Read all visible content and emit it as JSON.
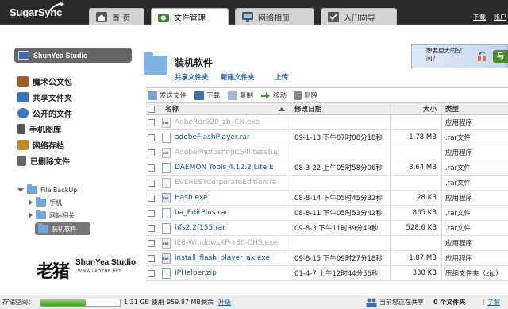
{
  "app": {
    "logo": "SugarSync"
  },
  "tabs": [
    {
      "label": "首 页"
    },
    {
      "label": "文件管理"
    },
    {
      "label": "网络相册"
    },
    {
      "label": "入门向导"
    }
  ],
  "top_links": [
    "下载",
    "账户"
  ],
  "sidebar": {
    "studio": "ShunYea Studio",
    "items": [
      {
        "label": "魔术公文包",
        "color": "#a0602a"
      },
      {
        "label": "共享文件夹",
        "color": "#3b74c0"
      },
      {
        "label": "公开的文件",
        "color": "#3b74c0"
      },
      {
        "label": "手机图库",
        "color": "#555555"
      },
      {
        "label": "网络存档",
        "color": "#c08a2a"
      },
      {
        "label": "已删除文件",
        "color": "#666666"
      }
    ],
    "tree": {
      "root": "File BackUp",
      "children": [
        "手机",
        "网站相关",
        "装机软件"
      ],
      "selected": "装机软件"
    },
    "brand": {
      "logo": "老猪",
      "name": "ShunYea Studio",
      "url": "WWW.LAOZHE.NET"
    }
  },
  "main": {
    "folder_title": "装机软件",
    "folder_actions": [
      "共享文件夹",
      "新建文件夹",
      "上传"
    ],
    "banner": {
      "text": "想要更大的空间？",
      "button": "马"
    },
    "toolbar": [
      "发送文件",
      "下载",
      "复制",
      "移动",
      "删除"
    ],
    "columns": {
      "name": "名称",
      "date": "修改日期",
      "size": "大小",
      "type": "类型"
    },
    "files": [
      {
        "name": "AdbeRdr920_zh_CN.exe",
        "date": "",
        "size": "",
        "type": "应用程序",
        "kind": "exe",
        "dim": true
      },
      {
        "name": "adobeFlashPlayer.rar",
        "date": "09-1-13 下午07时08分18秒",
        "size": "1.78 MB",
        "type": ".rar文件",
        "kind": "file",
        "dim": false
      },
      {
        "name": "AdobePhotoshopCS4litesetup",
        "date": "",
        "size": "",
        "type": "应用程序",
        "kind": "exe",
        "dim": true
      },
      {
        "name": "DAEMON Tools 4.12.2 Lite E",
        "date": "08-3-22 上午05时58分06秒",
        "size": "3.64 MB",
        "type": ".rar文件",
        "kind": "file",
        "dim": false
      },
      {
        "name": "EVERESTCorporateEdition.ra",
        "date": "",
        "size": "",
        "type": ".rar文件",
        "kind": "file",
        "dim": true
      },
      {
        "name": "Hash.exe",
        "date": "08-8-14 下午05时45分32秒",
        "size": "28 KB",
        "type": "应用程序",
        "kind": "exe",
        "dim": false
      },
      {
        "name": "ha_EditPlus.rar",
        "date": "08-8-11 下午05时53分42秒",
        "size": "865 KB",
        "type": ".rar文件",
        "kind": "file",
        "dim": false
      },
      {
        "name": "hfs2.2f155.rar",
        "date": "09-8-3 下午11时39分49秒",
        "size": "528.6 KB",
        "type": ".rar文件",
        "kind": "file",
        "dim": false
      },
      {
        "name": "IE8-WindowsXP-x86-CHS.exe",
        "date": "",
        "size": "",
        "type": "应用程序",
        "kind": "exe",
        "dim": true
      },
      {
        "name": "install_flash_player_ax.exe",
        "date": "09-8-15 下午09时27分18秒",
        "size": "1.87 MB",
        "type": "应用程序",
        "kind": "exe",
        "dim": false
      },
      {
        "name": "IPHelper.zip",
        "date": "01-4-7 上午12时44分56秒",
        "size": "330 KB",
        "type": "压缩文件夹（zip）",
        "kind": "file",
        "dim": false
      }
    ]
  },
  "status": {
    "storage_label": "存储空间：",
    "usage_fraction": 0.57,
    "used": "1.31 GB 使用",
    "remaining": "959.87 MB剩余",
    "upgrade": "升级",
    "sharing_text": "当前您正在共享",
    "sharing_count": "0 个文件夹",
    "learn_more": "了解"
  }
}
